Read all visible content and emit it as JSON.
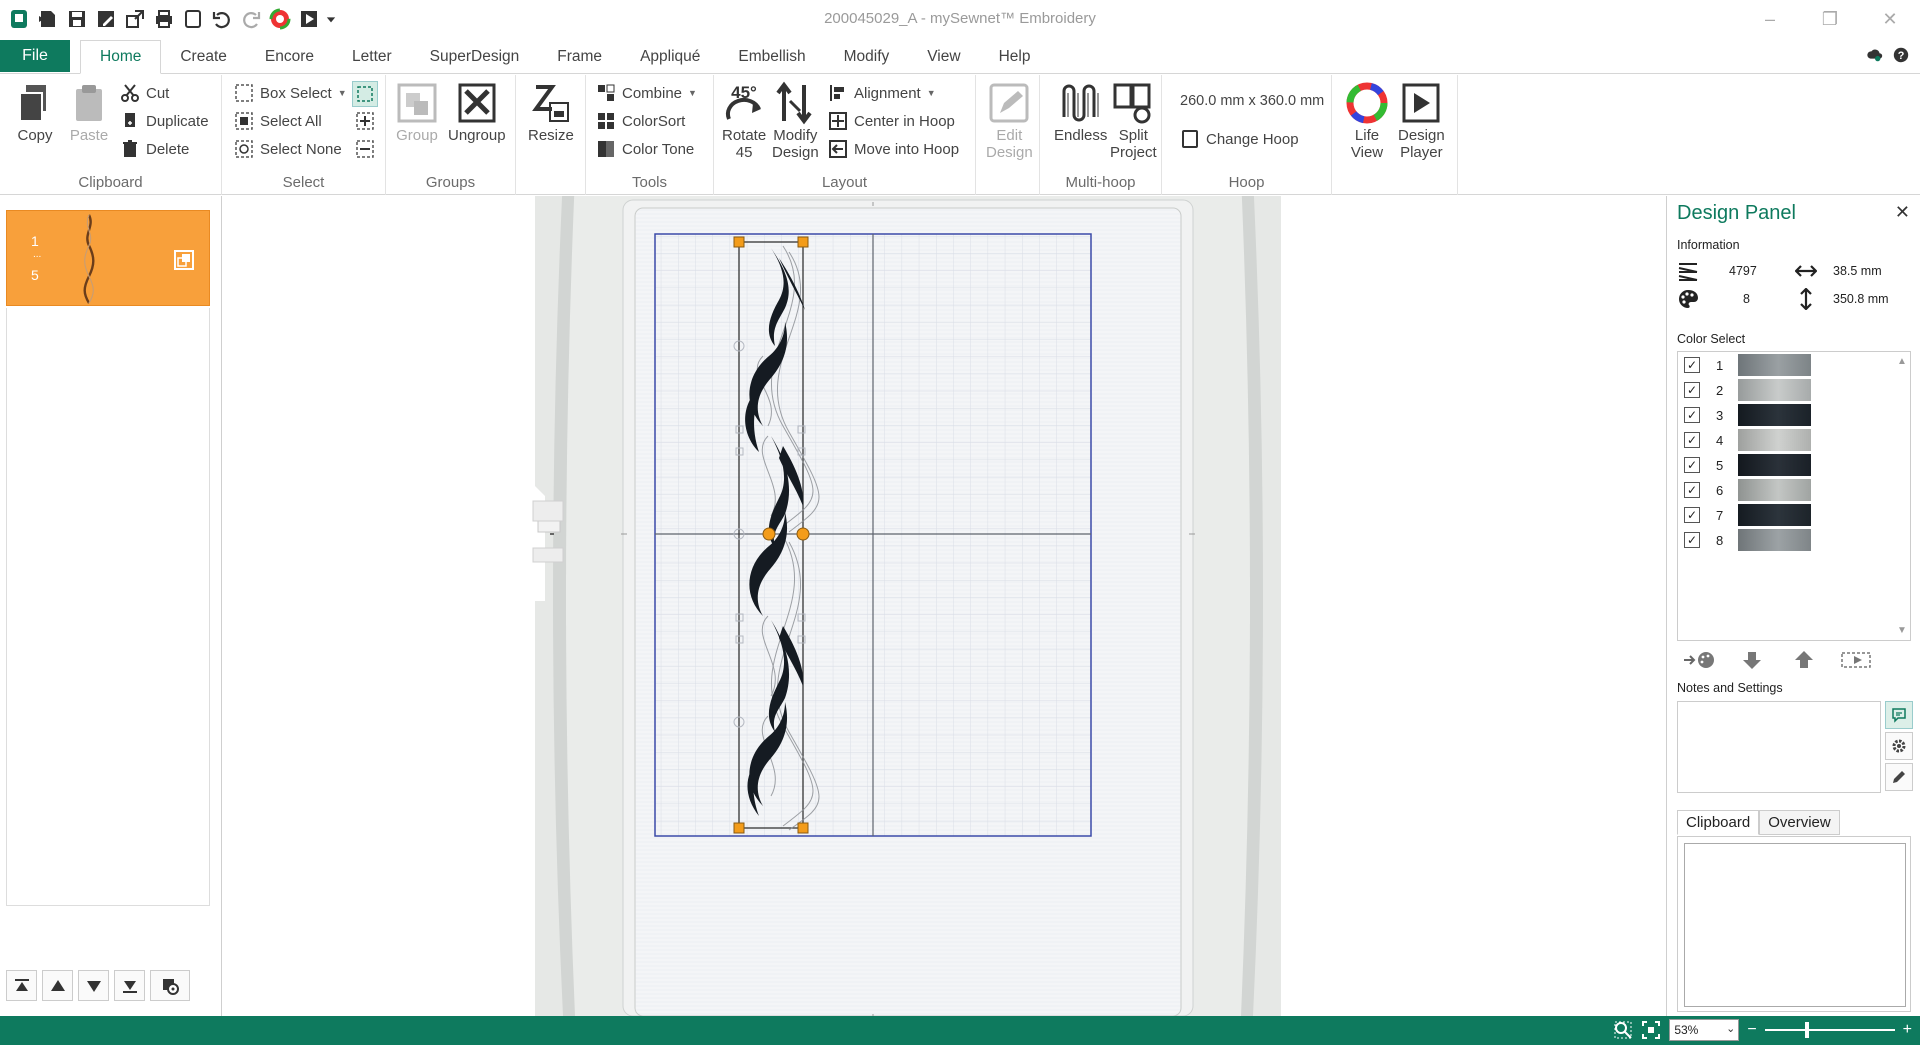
{
  "app": {
    "window_title": "200045029_A  -  mySewnet™ Embroidery",
    "controls": {
      "minimize": "–",
      "restore": "❐",
      "close": "✕"
    }
  },
  "menu": {
    "file": "File",
    "tabs": [
      "Home",
      "Create",
      "Encore",
      "Letter",
      "SuperDesign",
      "Frame",
      "Appliqué",
      "Embellish",
      "Modify",
      "View",
      "Help"
    ],
    "active_tab": "Home"
  },
  "ribbon": {
    "clipboard": {
      "label": "Clipboard",
      "copy": "Copy",
      "paste": "Paste",
      "cut": "Cut",
      "duplicate": "Duplicate",
      "delete": "Delete"
    },
    "select": {
      "label": "Select",
      "box_select": "Box Select",
      "select_all": "Select All",
      "select_none": "Select None"
    },
    "groups": {
      "label": "Groups",
      "group": "Group",
      "ungroup": "Ungroup"
    },
    "resize": {
      "label": "Resize"
    },
    "tools": {
      "label": "Tools",
      "combine": "Combine",
      "colorsort": "ColorSort",
      "colortone": "Color Tone"
    },
    "layout": {
      "label": "Layout",
      "rotate1": "Rotate",
      "rotate2": "45",
      "modify1": "Modify",
      "modify2": "Design",
      "alignment": "Alignment",
      "center_in_hoop": "Center in Hoop",
      "move_into_hoop": "Move into Hoop",
      "rotate_icon_text": "45°"
    },
    "multihoop": {
      "label": "Multi-hoop",
      "edit1": "Edit",
      "edit2": "Design",
      "endless": "Endless",
      "split1": "Split",
      "split2": "Project"
    },
    "hoop": {
      "label": "Hoop",
      "size": "260.0 mm x 360.0 mm",
      "change_hoop": "Change Hoop"
    },
    "view": {
      "life1": "Life",
      "life2": "View",
      "player1": "Design",
      "player2": "Player"
    }
  },
  "left_panel": {
    "thumb_first": "1",
    "thumb_dots": "...",
    "thumb_last": "5"
  },
  "design_panel": {
    "title": "Design Panel",
    "close": "✕",
    "information_label": "Information",
    "stitches": "4797",
    "width": "38.5 mm",
    "colors": "8",
    "height": "350.8 mm",
    "color_select_label": "Color Select",
    "color_rows": [
      {
        "num": "1",
        "checked": "✓",
        "color": "#7d8487"
      },
      {
        "num": "2",
        "checked": "✓",
        "color": "#a7abab"
      },
      {
        "num": "3",
        "checked": "✓",
        "color": "#1b2229"
      },
      {
        "num": "4",
        "checked": "✓",
        "color": "#aeb0ae"
      },
      {
        "num": "5",
        "checked": "✓",
        "color": "#1a2027"
      },
      {
        "num": "6",
        "checked": "✓",
        "color": "#a0a4a2"
      },
      {
        "num": "7",
        "checked": "✓",
        "color": "#1d242a"
      },
      {
        "num": "8",
        "checked": "✓",
        "color": "#7f8588"
      }
    ],
    "notes_label": "Notes and Settings",
    "bottom_tabs": [
      "Clipboard",
      "Overview"
    ]
  },
  "statusbar": {
    "zoom": "53%"
  },
  "colors": {
    "brand_green": "#0e7a5e",
    "selection_orange": "#f8a03b",
    "handle_orange": "#f39c1a"
  }
}
